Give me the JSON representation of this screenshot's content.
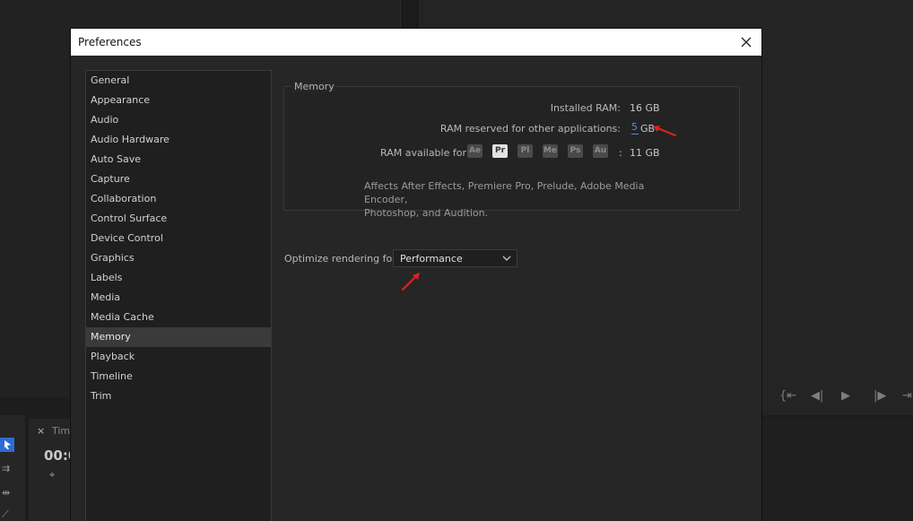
{
  "background": {
    "timeline_tab_close": "×",
    "timeline_tab_label": "Tim",
    "timecode": "00:0"
  },
  "dialog": {
    "title": "Preferences",
    "sidebar": {
      "items": [
        "General",
        "Appearance",
        "Audio",
        "Audio Hardware",
        "Auto Save",
        "Capture",
        "Collaboration",
        "Control Surface",
        "Device Control",
        "Graphics",
        "Labels",
        "Media",
        "Media Cache",
        "Memory",
        "Playback",
        "Timeline",
        "Trim"
      ],
      "selected": "Memory"
    },
    "memory": {
      "group_title": "Memory",
      "installed_label": "Installed RAM:",
      "installed_value": "16 GB",
      "reserved_label": "RAM reserved for other applications:",
      "reserved_value": "5",
      "reserved_unit": "GB",
      "available_label": "RAM available for",
      "apps": [
        "Ae",
        "Pr",
        "Pl",
        "Me",
        "Ps",
        "Au"
      ],
      "active_app": "Pr",
      "available_sep": ":",
      "available_value": "11 GB",
      "note_line1": "Affects After Effects, Premiere Pro, Prelude, Adobe Media Encoder,",
      "note_line2": "Photoshop, and Audition."
    },
    "optimize": {
      "label": "Optimize rendering for:",
      "value": "Performance"
    }
  },
  "colors": {
    "accent_link": "#4f8fe0",
    "annotation": "#e02020",
    "selected_tool": "#2c6bd6"
  }
}
